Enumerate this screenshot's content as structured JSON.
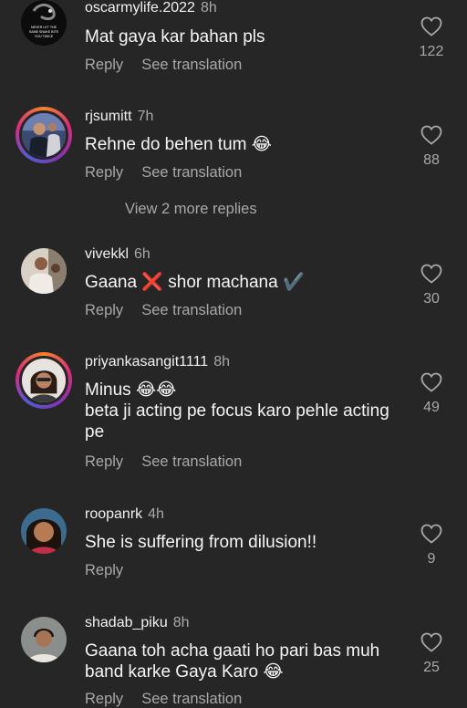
{
  "actions": {
    "reply": "Reply",
    "see_translation": "See translation"
  },
  "view_more_replies": "View 2 more replies",
  "avatar_logo_text": "NEVER LET THE SAME SNAKE BITE YOU TWICE",
  "comments": [
    {
      "username": "oscarmylife.2022",
      "time": "8h",
      "text": "Mat gaya kar bahan pls",
      "likes": "122"
    },
    {
      "username": "rjsumitt",
      "time": "7h",
      "text": "Rehne do behen tum 😂",
      "likes": "88"
    },
    {
      "username": "vivekkl",
      "time": "6h",
      "text": "Gaana ❌ shor machana ✔️",
      "likes": "30"
    },
    {
      "username": "priyankasangit1111",
      "time": "8h",
      "text": "Minus 😂😂\nbeta ji acting pe focus karo pehle acting pe",
      "likes": "49"
    },
    {
      "username": "roopanrk",
      "time": "4h",
      "text": "She is suffering from dilusion!!",
      "likes": "9"
    },
    {
      "username": "shadab_piku",
      "time": "8h",
      "text": "Gaana toh acha gaati ho pari bas muh band karke Gaya Karo 😂",
      "likes": "25"
    }
  ]
}
